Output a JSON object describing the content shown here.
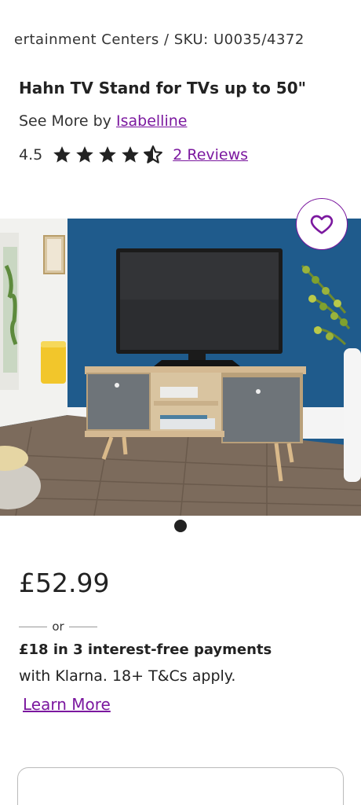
{
  "breadcrumb": {
    "text": "ertainment Centers / SKU: U0035/4372"
  },
  "product": {
    "title": "Hahn TV Stand for TVs up to 50\"",
    "see_more_prefix": "See More by",
    "brand": "Isabelline",
    "rating": "4.5",
    "stars": 4.5,
    "reviews_link": "2 Reviews"
  },
  "gallery": {
    "slide_count": 1,
    "active_slide": 1
  },
  "pricing": {
    "price": "£52.99",
    "or_label": "or",
    "installments": "£18 in 3 interest-free payments",
    "klarna_note": "with Klarna. 18+ T&Cs apply.",
    "learn_more": "Learn More"
  },
  "icons": {
    "favorite": "heart-icon",
    "rating": "star-icon"
  },
  "colors": {
    "accent": "#7b189f",
    "text": "#222222",
    "wall": "#1f5b8c"
  }
}
